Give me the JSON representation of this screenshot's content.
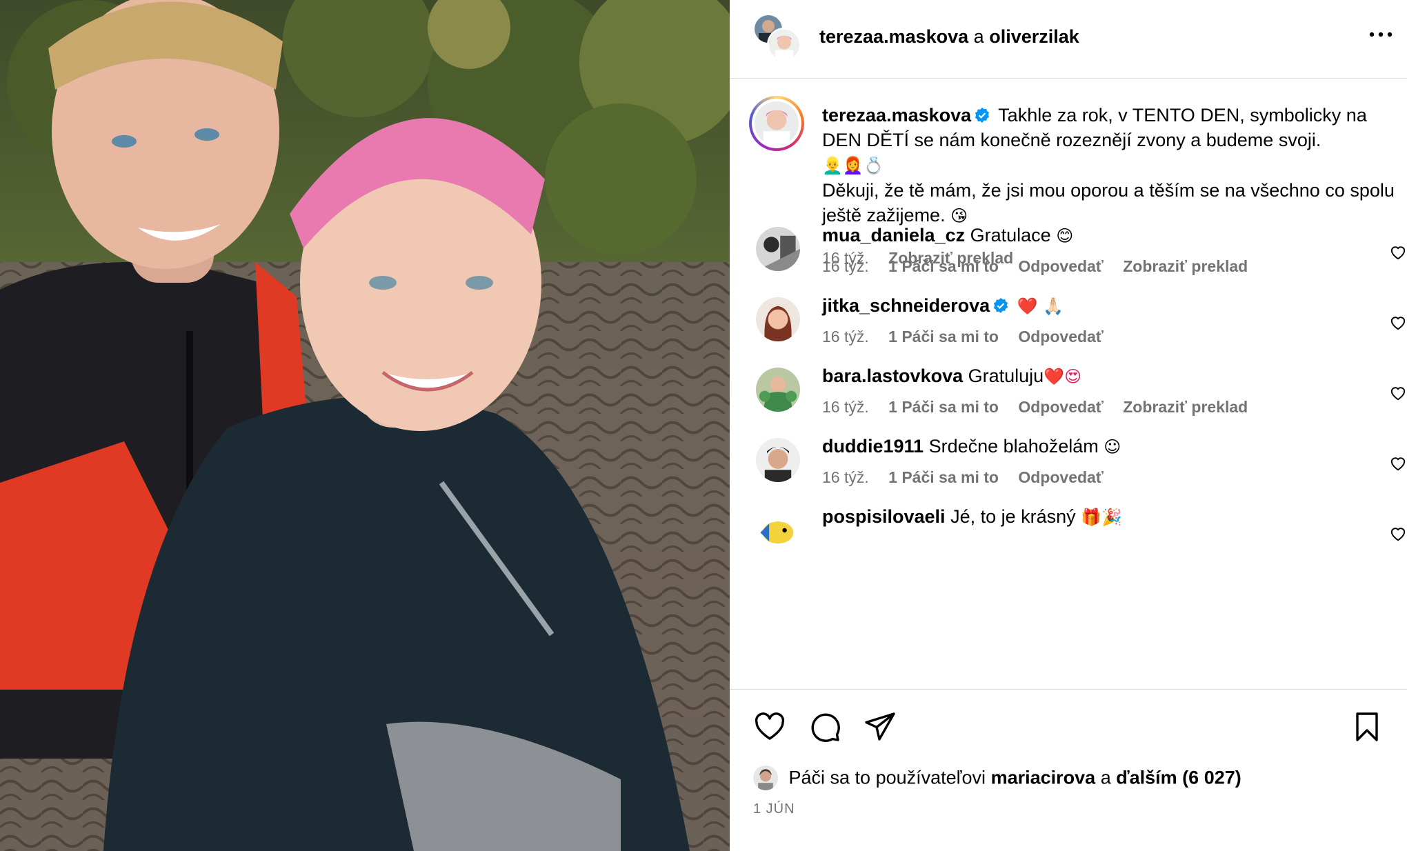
{
  "header": {
    "user1": "terezaa.maskova",
    "separator": "a",
    "user2": "oliverzilak",
    "more_icon": "more-horizontal-icon"
  },
  "caption": {
    "username": "terezaa.maskova",
    "verified_icon": "verified-badge-icon",
    "text_line1": "Takhle za rok, v TENTO DEN, symbolicky na DEN DĚTÍ se nám konečně rozeznějí zvony a budeme svoji.",
    "emojis_line": "👱‍♂️👩‍🦰💍",
    "text_line2": "Děkuji, že tě mám, že jsi mou oporou a těším se na všechno co spolu ještě zažijeme.",
    "text_line2_emoji": "😘",
    "time": "16 týž.",
    "translate": "Zobraziť preklad"
  },
  "comments": [
    {
      "username": "mua_daniela_cz",
      "verified": false,
      "text": "Gratulace",
      "emoji": "😊",
      "time": "16 týž.",
      "likes": "1 Páči sa mi to",
      "reply": "Odpovedať",
      "translate": "Zobraziť preklad"
    },
    {
      "username": "jitka_schneiderova",
      "verified": true,
      "text": "",
      "emoji": "❤️ 🙏🏻",
      "time": "16 týž.",
      "likes": "1 Páči sa mi to",
      "reply": "Odpovedať",
      "translate": ""
    },
    {
      "username": "bara.lastovkova",
      "verified": false,
      "text": "Gratuluju",
      "emoji": "❤️😍",
      "time": "16 týž.",
      "likes": "1 Páči sa mi to",
      "reply": "Odpovedať",
      "translate": "Zobraziť preklad"
    },
    {
      "username": "duddie1911",
      "verified": false,
      "text": "Srdečne blahoželám",
      "emoji": "☺",
      "time": "16 týž.",
      "likes": "1 Páči sa mi to",
      "reply": "Odpovedať",
      "translate": ""
    },
    {
      "username": "pospisilovaeli",
      "verified": false,
      "text": "Jé, to je krásný",
      "emoji": "🎁🎉",
      "time": "",
      "likes": "",
      "reply": "",
      "translate": ""
    }
  ],
  "actions": {
    "like_icon": "heart-icon",
    "comment_icon": "comment-icon",
    "share_icon": "share-icon",
    "save_icon": "bookmark-icon"
  },
  "likes": {
    "prefix": "Páči sa to používateľovi",
    "user": "mariacirova",
    "joiner": "a",
    "others": "ďalším (6 027)"
  },
  "date": "1 JÚN",
  "colors": {
    "link_gray": "#737373",
    "verified_blue": "#0095f6",
    "divider": "#dbdbdb"
  }
}
